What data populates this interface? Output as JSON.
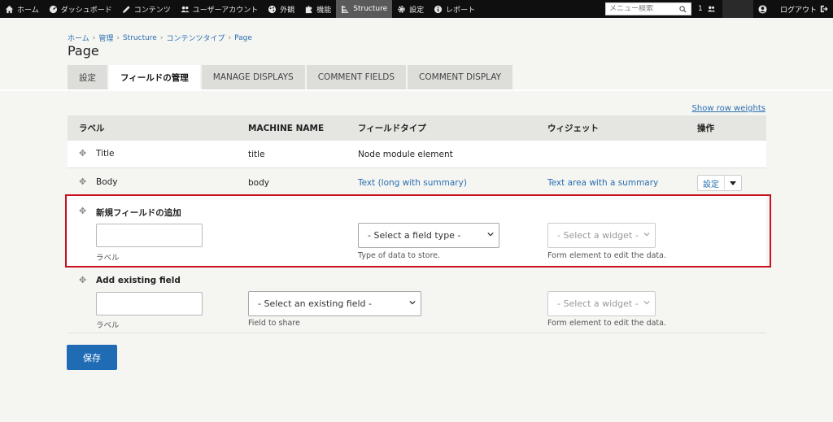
{
  "toolbar": {
    "items": [
      {
        "label": "ホーム",
        "icon": "home-icon"
      },
      {
        "label": "ダッシュボード",
        "icon": "dashboard-icon"
      },
      {
        "label": "コンテンツ",
        "icon": "pencil-icon"
      },
      {
        "label": "ユーザーアカウント",
        "icon": "users-icon"
      },
      {
        "label": "外観",
        "icon": "palette-icon"
      },
      {
        "label": "機能",
        "icon": "puzzle-icon"
      },
      {
        "label": "Structure",
        "icon": "structure-icon"
      },
      {
        "label": "設定",
        "icon": "gear-icon"
      },
      {
        "label": "レポート",
        "icon": "info-icon"
      }
    ],
    "search_placeholder": "メニュー検索",
    "user_count": "1",
    "logout_label": "ログアウト"
  },
  "breadcrumb": [
    "ホーム",
    "管理",
    "Structure",
    "コンテンツタイプ",
    "Page"
  ],
  "page_title": "Page",
  "tabs": [
    "設定",
    "フィールドの管理",
    "MANAGE DISPLAYS",
    "COMMENT FIELDS",
    "COMMENT DISPLAY"
  ],
  "show_row_weights": "Show row weights",
  "table": {
    "headers": {
      "label": "ラベル",
      "machine_name": "MACHINE NAME",
      "field_type": "フィールドタイプ",
      "widget": "ウィジェット",
      "operations": "操作"
    },
    "rows": [
      {
        "label": "Title",
        "machine": "title",
        "type": "Node module element",
        "widget": ""
      },
      {
        "label": "Body",
        "machine": "body",
        "type": "Text (long with summary)",
        "widget": "Text area with a summary",
        "op": "設定"
      }
    ]
  },
  "new_field": {
    "title": "新規フィールドの追加",
    "label_desc": "ラベル",
    "type_select": "- Select a field type -",
    "type_desc": "Type of data to store.",
    "widget_select": "- Select a widget -",
    "widget_desc": "Form element to edit the data."
  },
  "existing_field": {
    "title": "Add existing field",
    "label_desc": "ラベル",
    "field_select": "- Select an existing field -",
    "field_desc": "Field to share",
    "widget_select": "- Select a widget -",
    "widget_desc": "Form element to edit the data."
  },
  "save_label": "保存"
}
